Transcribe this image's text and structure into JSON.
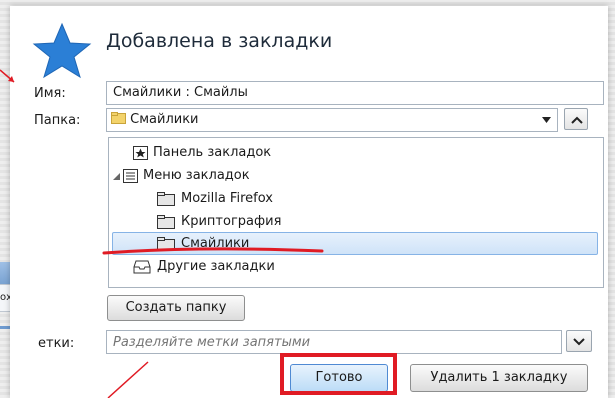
{
  "dialog": {
    "title": "Добавлена в закладки",
    "name_label": "Имя:",
    "name_value": "Смайлики : Смайлы",
    "folder_label": "Папка:",
    "folder_value": "Смайлики",
    "tree": {
      "items": [
        {
          "label": "Панель закладок",
          "icon": "star-box-icon"
        },
        {
          "label": "Меню закладок",
          "icon": "menu-list-icon"
        },
        {
          "label": "Mozilla Firefox",
          "icon": "folder-icon"
        },
        {
          "label": "Криптография",
          "icon": "folder-icon"
        },
        {
          "label": "Смайлики",
          "icon": "folder-icon",
          "selected": true
        },
        {
          "label": "Другие закладки",
          "icon": "inbox-icon"
        }
      ]
    },
    "new_folder_label": "Создать папку",
    "tags_label": "етки:",
    "tags_placeholder": "Разделяйте метки запятыми",
    "done_label": "Готово",
    "delete_label": "Удалить 1 закладку"
  },
  "background": {
    "toolbar_text": "охранит"
  },
  "colors": {
    "star": "#2b7fd6",
    "annotation_red": "#e01b24",
    "selection": "#cfe3f8"
  }
}
